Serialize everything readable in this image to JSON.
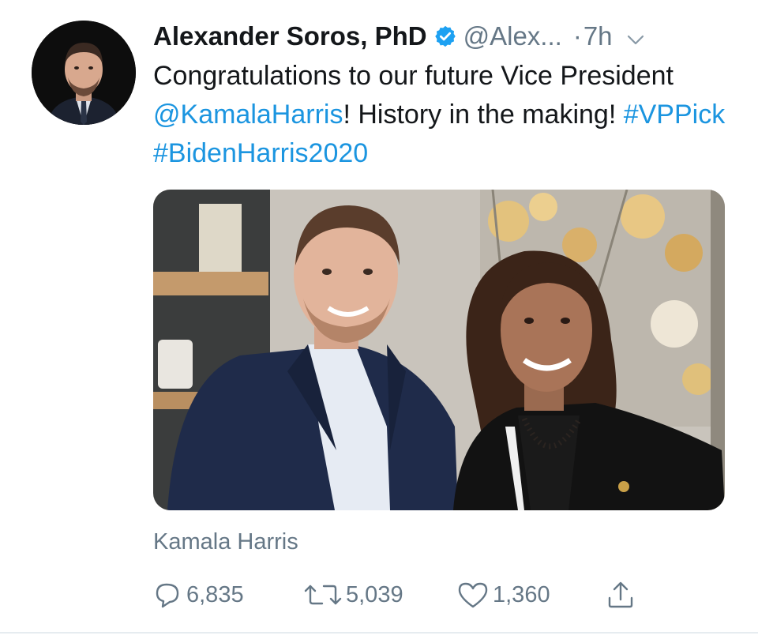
{
  "tweet": {
    "display_name": "Alexander Soros, PhD",
    "handle": "@Alex...",
    "separator": "·",
    "time": "7h",
    "text": {
      "part1": "Congratulations to our future Vice President ",
      "mention": "@KamalaHarris",
      "part2": "! History in the making! ",
      "hashtag1": "#VPPick",
      "space": " ",
      "hashtag2": "#BidenHarris2020"
    },
    "photo_tag": "Kamala Harris",
    "counts": {
      "replies": "6,835",
      "retweets": "5,039",
      "likes": "1,360"
    }
  },
  "icons": {
    "verified": "verified-badge-icon",
    "caret": "chevron-down-icon",
    "reply": "reply-icon",
    "retweet": "retweet-icon",
    "like": "heart-icon",
    "share": "share-icon"
  },
  "colors": {
    "link": "#1b95e0",
    "secondary_text": "#657786",
    "primary_text": "#14171a",
    "verified": "#1da1f2"
  }
}
